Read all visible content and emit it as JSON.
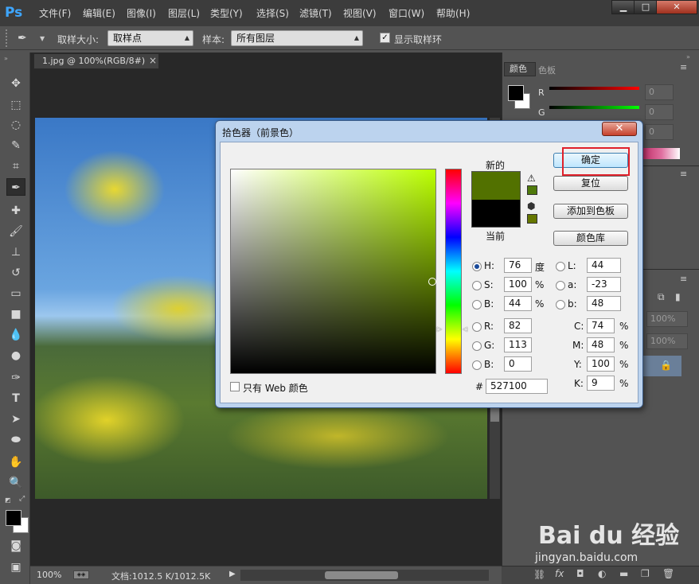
{
  "app": {
    "logo": "Ps"
  },
  "menu": [
    "文件(F)",
    "编辑(E)",
    "图像(I)",
    "图层(L)",
    "类型(Y)",
    "选择(S)",
    "滤镜(T)",
    "视图(V)",
    "窗口(W)",
    "帮助(H)"
  ],
  "window_buttons": {
    "minimize": "▁",
    "restore": "□",
    "close": "✕"
  },
  "options_bar": {
    "sample_size_label": "取样大小:",
    "sample_size_value": "取样点",
    "sample_label": "样本:",
    "sample_value": "所有图层",
    "show_ring_label": "显示取样环",
    "show_ring_checked": true
  },
  "document": {
    "tab_title": "1.jpg @ 100%(RGB/8#)",
    "tab_close": "×",
    "zoom": "100%",
    "doc_info": "文档:1012.5 K/1012.5K"
  },
  "color_panel": {
    "tabs": [
      "颜色",
      "色板"
    ],
    "channels": [
      {
        "label": "R",
        "value": "0"
      },
      {
        "label": "G",
        "value": "0"
      },
      {
        "label": "B",
        "value": "0"
      }
    ]
  },
  "layers_panel": {
    "opacity_1": "100%",
    "opacity_2": "100%"
  },
  "color_picker": {
    "title": "拾色器（前景色）",
    "new_label": "新的",
    "current_label": "当前",
    "new_color": "#527100",
    "current_color": "#000000",
    "buttons": {
      "ok": "确定",
      "reset": "复位",
      "add_swatch": "添加到色板",
      "libraries": "颜色库"
    },
    "hsb": [
      {
        "label": "H:",
        "value": "76",
        "unit": "度",
        "selected": true
      },
      {
        "label": "S:",
        "value": "100",
        "unit": "%",
        "selected": false
      },
      {
        "label": "B:",
        "value": "44",
        "unit": "%",
        "selected": false
      }
    ],
    "rgb": [
      {
        "label": "R:",
        "value": "82"
      },
      {
        "label": "G:",
        "value": "113"
      },
      {
        "label": "B:",
        "value": "0"
      }
    ],
    "lab": [
      {
        "label": "L:",
        "value": "44"
      },
      {
        "label": "a:",
        "value": "-23"
      },
      {
        "label": "b:",
        "value": "48"
      }
    ],
    "cmyk": [
      {
        "label": "C:",
        "value": "74",
        "unit": "%"
      },
      {
        "label": "M:",
        "value": "48",
        "unit": "%"
      },
      {
        "label": "Y:",
        "value": "100",
        "unit": "%"
      },
      {
        "label": "K:",
        "value": "9",
        "unit": "%"
      }
    ],
    "hex_label": "#",
    "hex_value": "527100",
    "web_only_label": "只有 Web 颜色",
    "web_only_checked": false
  },
  "watermark": {
    "brand": "Bai du 经验",
    "url": "jingyan.baidu.com"
  }
}
